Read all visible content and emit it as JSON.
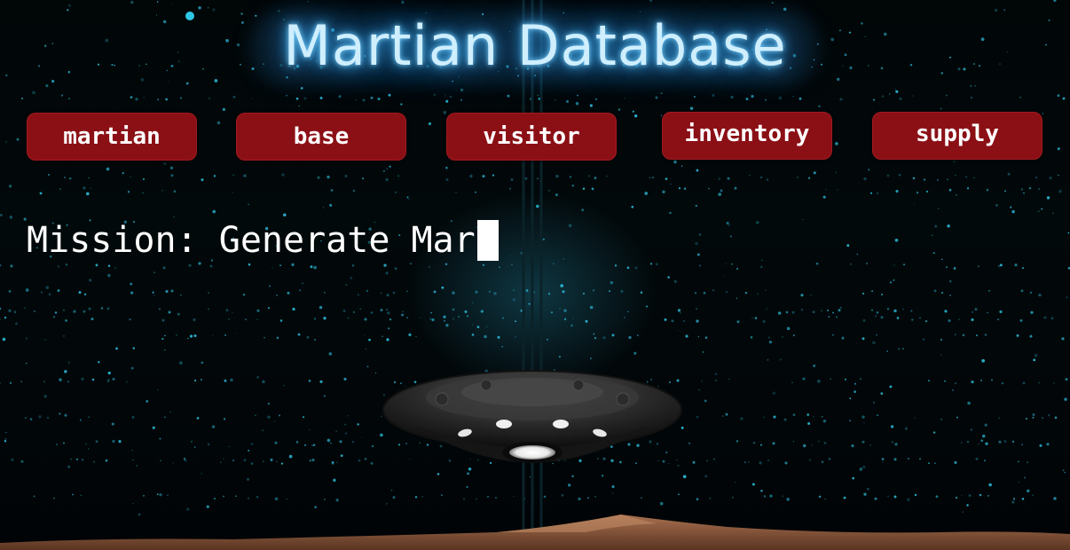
{
  "header": {
    "title": "Martian Database"
  },
  "nav": {
    "items": [
      {
        "label": "martian"
      },
      {
        "label": "base"
      },
      {
        "label": "visitor"
      },
      {
        "label": "inventory"
      },
      {
        "label": "supply"
      }
    ]
  },
  "mission": {
    "text": "Mission: Generate Mar"
  },
  "colors": {
    "button_bg": "#8b1016",
    "title_glow": "#3fa9e8",
    "stars": "#2fc6e6",
    "ground": "#8a5a3c"
  },
  "icons": {
    "ufo": "ufo-icon"
  }
}
